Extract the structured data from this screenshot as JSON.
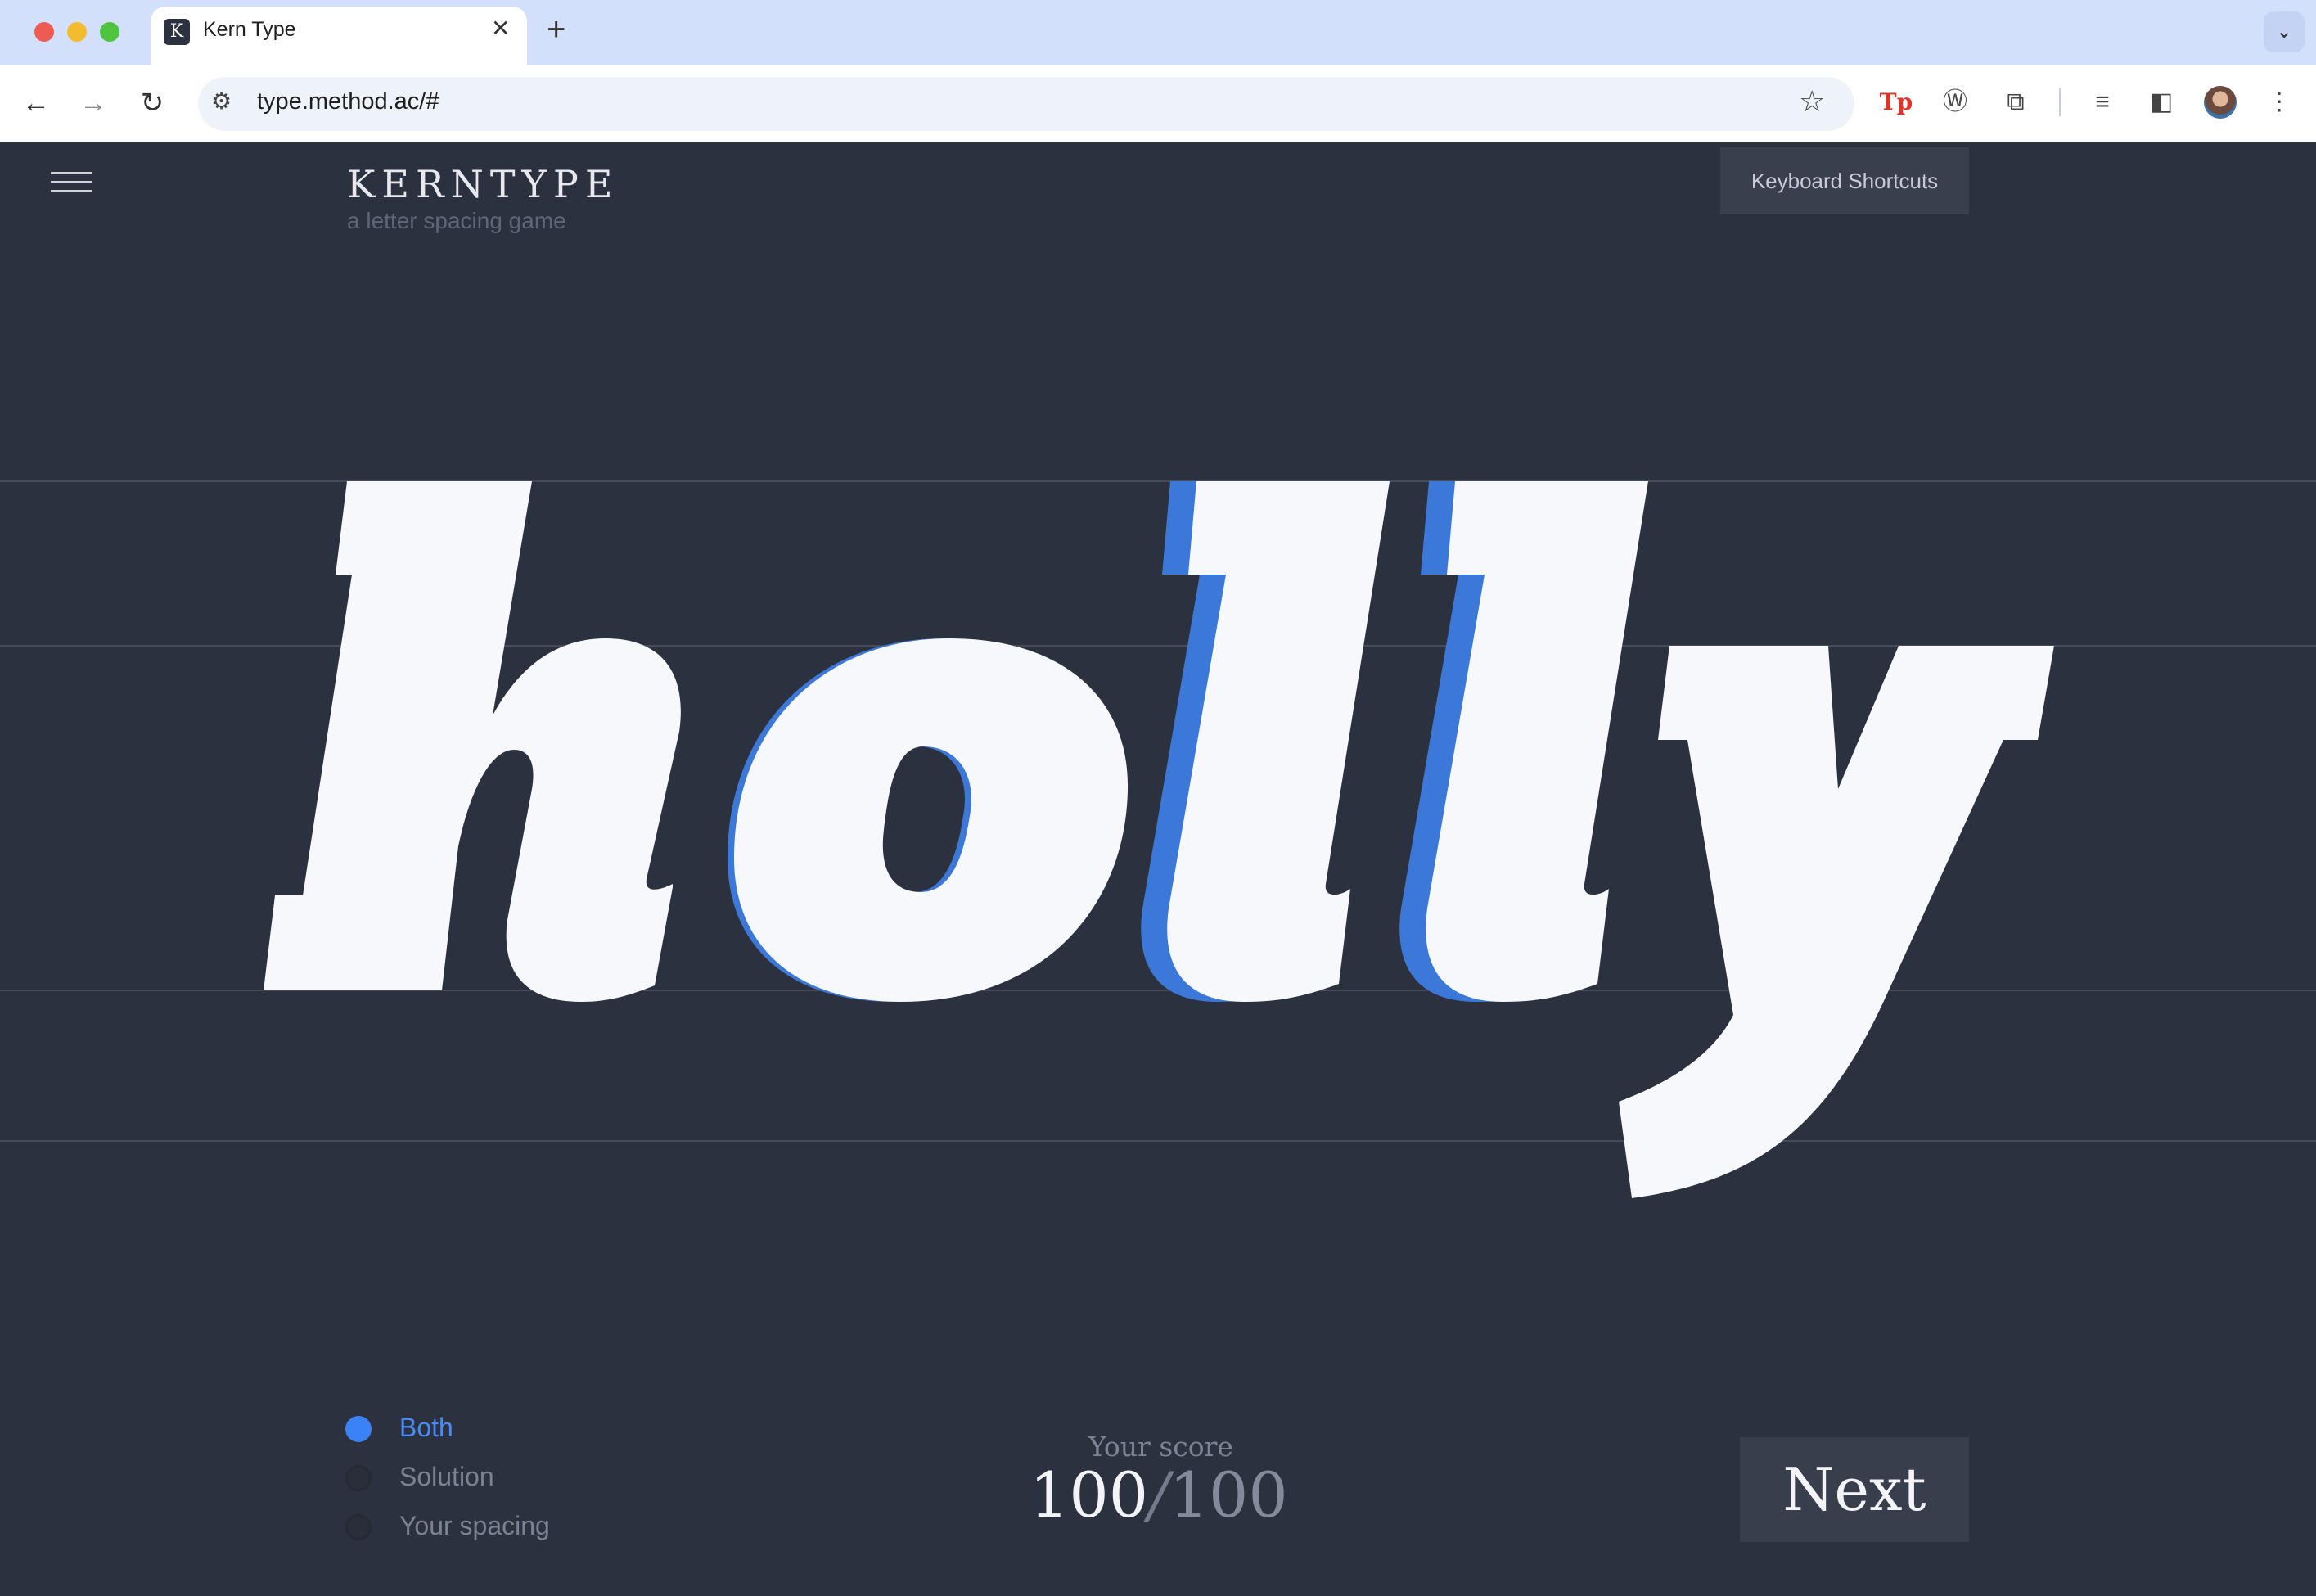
{
  "browser": {
    "tab_title": "Kern Type",
    "tab_favicon_letter": "K",
    "url": "type.method.ac/#"
  },
  "header": {
    "logo": "KERNTYPE",
    "tagline": "a letter spacing game",
    "keyboard_shortcuts": "Keyboard Shortcuts"
  },
  "game": {
    "word": "holly",
    "solution_color": "#3b78d8",
    "letter_color": "#f6f8fb"
  },
  "view_options": [
    {
      "label": "Both",
      "selected": true
    },
    {
      "label": "Solution",
      "selected": false
    },
    {
      "label": "Your spacing",
      "selected": false
    }
  ],
  "score": {
    "caption": "Your score",
    "value": "100",
    "separator": "/",
    "max": "100"
  },
  "next_label": "Next",
  "colors": {
    "background": "#2c3140",
    "accent": "#3b82f6"
  }
}
